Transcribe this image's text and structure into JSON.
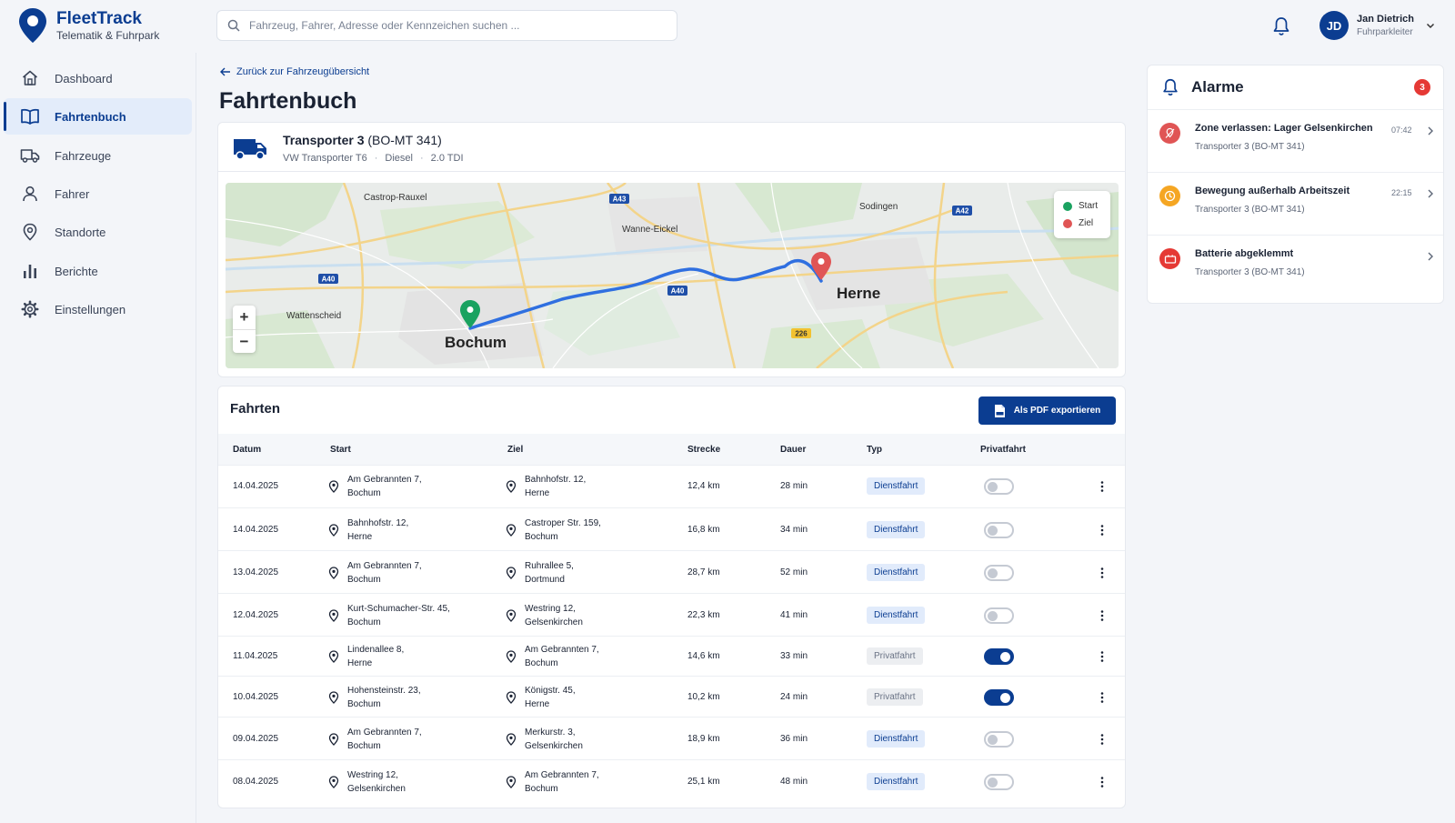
{
  "app": {
    "title": "FleetTrack",
    "subtitle": "Telematik & Fuhrpark"
  },
  "search": {
    "placeholder": "Fahrzeug, Fahrer, Adresse oder Kennzeichen suchen ..."
  },
  "user": {
    "initials": "JD",
    "name": "Jan Dietrich",
    "role": "Fuhrparkleiter"
  },
  "nav": [
    {
      "label": "Dashboard",
      "icon": "home-icon"
    },
    {
      "label": "Fahrtenbuch",
      "icon": "book-icon",
      "active": true
    },
    {
      "label": "Fahrzeuge",
      "icon": "truck-icon"
    },
    {
      "label": "Fahrer",
      "icon": "person-icon"
    },
    {
      "label": "Standorte",
      "icon": "location-pin-icon"
    },
    {
      "label": "Berichte",
      "icon": "bar-chart-icon"
    },
    {
      "label": "Einstellungen",
      "icon": "gear-icon"
    }
  ],
  "page": {
    "back_link": "Zurück zur Fahrzeugübersicht",
    "title": "Fahrtenbuch"
  },
  "vehicle": {
    "name": "Transporter 3",
    "plate": "(BO-MT 341)",
    "model": "VW Transporter T6",
    "fuel": "Diesel",
    "engine": "2.0 TDI"
  },
  "map": {
    "labels": {
      "castrop": "Castrop-Rauxel",
      "wanne": "Wanne-Eickel",
      "sodingen": "Sodingen",
      "wattenscheid": "Wattenscheid",
      "bochum": "Bochum",
      "herne": "Herne"
    },
    "road_shields": {
      "a43": "A43",
      "a42": "A42",
      "a40_left": "A40",
      "a40_mid": "A40",
      "b226": "226"
    },
    "legend": {
      "start": "Start",
      "ziel": "Ziel"
    },
    "zoom_in": "+",
    "zoom_out": "−",
    "colors": {
      "route": "#2f6fe0",
      "start": "#1aa260",
      "end": "#e05555"
    }
  },
  "trips": {
    "title": "Fahrten",
    "export_label": "Als PDF exportieren",
    "columns": {
      "datum": "Datum",
      "start": "Start",
      "ziel": "Ziel",
      "strecke": "Strecke",
      "dauer": "Dauer",
      "typ": "Typ",
      "privat": "Privatfahrt"
    },
    "rows": [
      {
        "datum": "14.04.2025",
        "start1": "Am Gebrannten 7,",
        "start2": "Bochum",
        "ziel1": "Bahnhofstr. 12,",
        "ziel2": "Herne",
        "strecke": "12,4 km",
        "dauer": "28 min",
        "typ": "Dienstfahrt",
        "privat": false
      },
      {
        "datum": "14.04.2025",
        "start1": "Bahnhofstr. 12,",
        "start2": "Herne",
        "ziel1": "Castroper Str. 159,",
        "ziel2": "Bochum",
        "strecke": "16,8 km",
        "dauer": "34 min",
        "typ": "Dienstfahrt",
        "privat": false
      },
      {
        "datum": "13.04.2025",
        "start1": "Am Gebrannten 7,",
        "start2": "Bochum",
        "ziel1": "Ruhrallee 5,",
        "ziel2": "Dortmund",
        "strecke": "28,7 km",
        "dauer": "52 min",
        "typ": "Dienstfahrt",
        "privat": false
      },
      {
        "datum": "12.04.2025",
        "start1": "Kurt-Schumacher-Str. 45,",
        "start2": "Bochum",
        "ziel1": "Westring 12,",
        "ziel2": "Gelsenkirchen",
        "strecke": "22,3 km",
        "dauer": "41 min",
        "typ": "Dienstfahrt",
        "privat": false
      },
      {
        "datum": "11.04.2025",
        "start1": "Lindenallee 8,",
        "start2": "Herne",
        "ziel1": "Am Gebrannten 7,",
        "ziel2": "Bochum",
        "strecke": "14,6 km",
        "dauer": "33 min",
        "typ": "Privatfahrt",
        "privat": true
      },
      {
        "datum": "10.04.2025",
        "start1": "Hohensteinstr. 23,",
        "start2": "Bochum",
        "ziel1": "Königstr. 45,",
        "ziel2": "Herne",
        "strecke": "10,2 km",
        "dauer": "24 min",
        "typ": "Privatfahrt",
        "privat": true
      },
      {
        "datum": "09.04.2025",
        "start1": "Am Gebrannten 7,",
        "start2": "Bochum",
        "ziel1": "Merkurstr. 3,",
        "ziel2": "Gelsenkirchen",
        "strecke": "18,9 km",
        "dauer": "36 min",
        "typ": "Dienstfahrt",
        "privat": false
      },
      {
        "datum": "08.04.2025",
        "start1": "Westring 12,",
        "start2": "Gelsenkirchen",
        "ziel1": "Am Gebrannten 7,",
        "ziel2": "Bochum",
        "strecke": "25,1 km",
        "dauer": "48 min",
        "typ": "Dienstfahrt",
        "privat": false
      }
    ]
  },
  "alarms": {
    "title": "Alarme",
    "count": "3",
    "items": [
      {
        "title": "Zone verlassen: Lager Gelsenkirchen",
        "vehicle": "Transporter 3 (BO-MT 341)",
        "time": "07:42",
        "icon": "geofence-alert-icon",
        "color": "#e05555"
      },
      {
        "title": "Bewegung außerhalb Arbeitszeit",
        "vehicle": "Transporter 3 (BO-MT 341)",
        "time": "22:15",
        "icon": "clock-icon",
        "color": "#f5a623"
      },
      {
        "title": "Batterie abgeklemmt",
        "vehicle": "Transporter 3 (BO-MT 341)",
        "time": "",
        "icon": "battery-icon",
        "color": "#e53935"
      }
    ]
  }
}
